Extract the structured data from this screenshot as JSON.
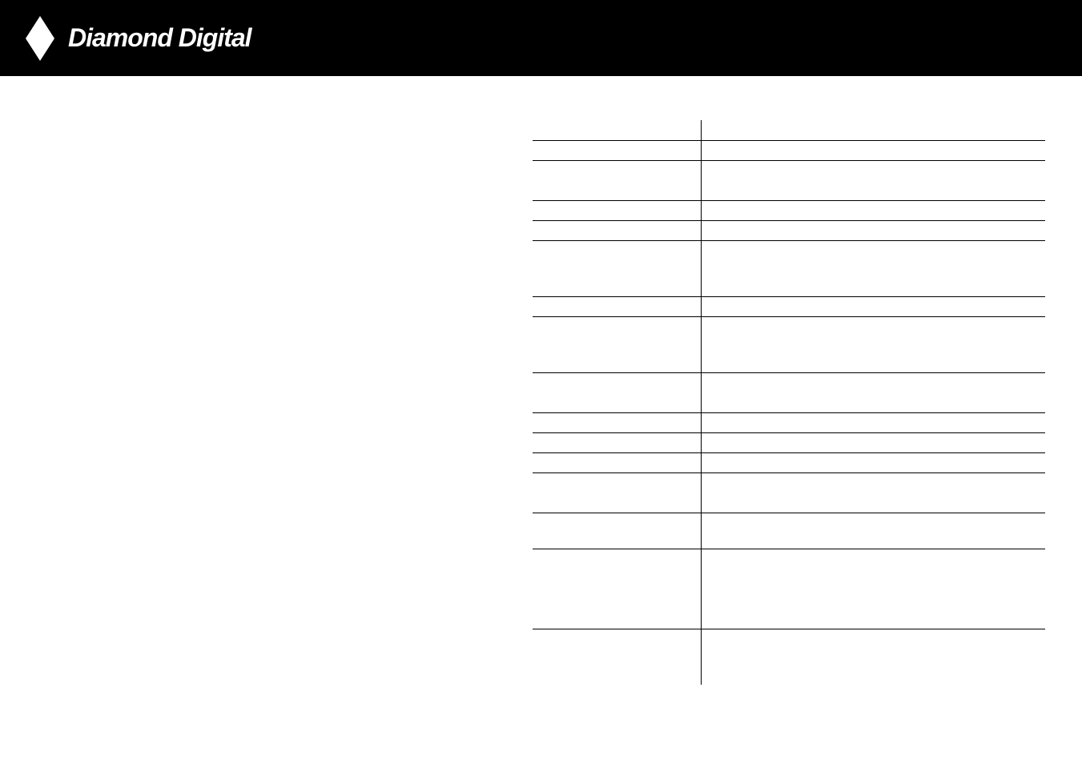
{
  "header": {
    "brand": "Diamond Digital"
  },
  "table": {
    "rows": [
      {
        "height": "h25",
        "no_top": true
      },
      {
        "height": "h25"
      },
      {
        "height": "h50"
      },
      {
        "height": "h25"
      },
      {
        "height": "h25"
      },
      {
        "height": "h70"
      },
      {
        "height": "h25"
      },
      {
        "height": "h70"
      },
      {
        "height": "h50"
      },
      {
        "height": "h25"
      },
      {
        "height": "h25"
      },
      {
        "height": "h25"
      },
      {
        "height": "h50"
      },
      {
        "height": "h45"
      },
      {
        "height": "h100"
      },
      {
        "height": "h70"
      }
    ]
  }
}
